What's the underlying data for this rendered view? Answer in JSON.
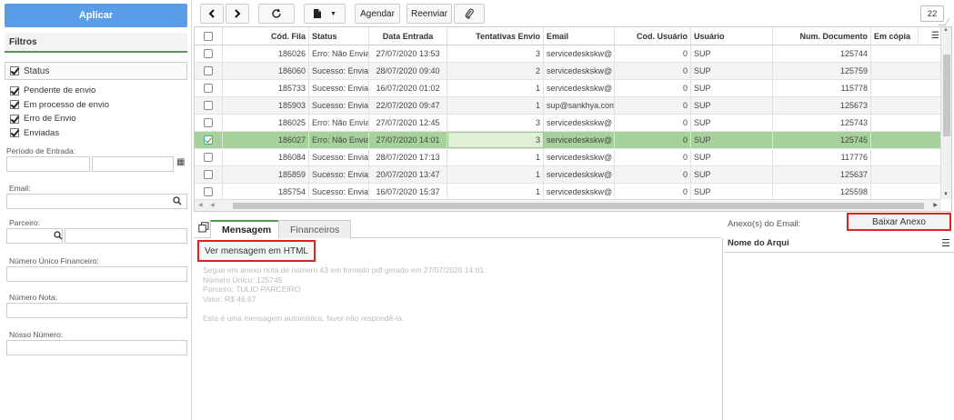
{
  "left": {
    "apply": "Aplicar",
    "filters_title": "Filtros",
    "status_label": "Status",
    "status_options": [
      "Pendente de envio",
      "Em processo de envio",
      "Erro de Envio",
      "Enviadas"
    ],
    "periodo_label": "Período de Entrada:",
    "email_label": "Email:",
    "parceiro_label": "Parceiro:",
    "numero_unico_label": "Número Único Financeiro:",
    "numero_nota_label": "Número Nota:",
    "nosso_numero_label": "Nosso Número:"
  },
  "toolbar": {
    "agendar": "Agendar",
    "reenviar": "Reenviar",
    "count": "22"
  },
  "grid": {
    "columns": [
      "Cód. Fila",
      "Status",
      "Data Entrada",
      "Tentativas Envio",
      "Email",
      "Cod. Usuário",
      "Usuário",
      "Num. Documento",
      "Em cópia"
    ],
    "rows": [
      [
        "186026",
        "Erro: Não Enviada",
        "27/07/2020 13:53",
        "3",
        "servicedeskskw@",
        "0",
        "SUP",
        "125744"
      ],
      [
        "186060",
        "Sucesso: Enviada",
        "28/07/2020 09:40",
        "2",
        "servicedeskskw@",
        "0",
        "SUP",
        "125759"
      ],
      [
        "185733",
        "Sucesso: Enviada",
        "16/07/2020 01:02",
        "1",
        "servicedeskskw@",
        "0",
        "SUP",
        "115778"
      ],
      [
        "185903",
        "Sucesso: Enviada",
        "22/07/2020 09:47",
        "1",
        "sup@sankhya.com",
        "0",
        "SUP",
        "125673"
      ],
      [
        "186025",
        "Erro: Não Enviada",
        "27/07/2020 12:45",
        "3",
        "servicedeskskw@",
        "0",
        "SUP",
        "125743"
      ],
      [
        "186027",
        "Erro: Não Enviada",
        "27/07/2020 14:01",
        "3",
        "servicedeskskw@",
        "0",
        "SUP",
        "125745"
      ],
      [
        "186084",
        "Sucesso: Enviada",
        "28/07/2020 17:13",
        "1",
        "servicedeskskw@",
        "0",
        "SUP",
        "117776"
      ],
      [
        "185859",
        "Sucesso: Enviada",
        "20/07/2020 13:47",
        "1",
        "servicedeskskw@",
        "0",
        "SUP",
        "125637"
      ],
      [
        "185754",
        "Sucesso: Enviada",
        "16/07/2020 15:37",
        "1",
        "servicedeskskw@",
        "0",
        "SUP",
        "125598"
      ]
    ],
    "selected_row": 5
  },
  "tabs": [
    "Mensagem",
    "Financeiros"
  ],
  "message": {
    "html_button": "Ver mensagem em HTML",
    "lines": [
      "Segue em anexo nota de número 43 em formato pdf gerado em 27/07/2020 14:01.",
      "Número Único: 125745",
      "Parceiro: TULIO PARCEIRO",
      "Valor: R$ 46,67",
      "",
      "Esta é uma mensagem automática, favor não respondê-la."
    ]
  },
  "attachments": {
    "label": "Anexo(s) do Email:",
    "download_button": "Baixar Anexo",
    "column": "Nome do Arqui"
  },
  "colors": {
    "apply_bg": "#5b9ce8",
    "selected_row": "#a7d19b",
    "accent_green": "#4aa04a",
    "highlight_red": "#dd2222"
  }
}
